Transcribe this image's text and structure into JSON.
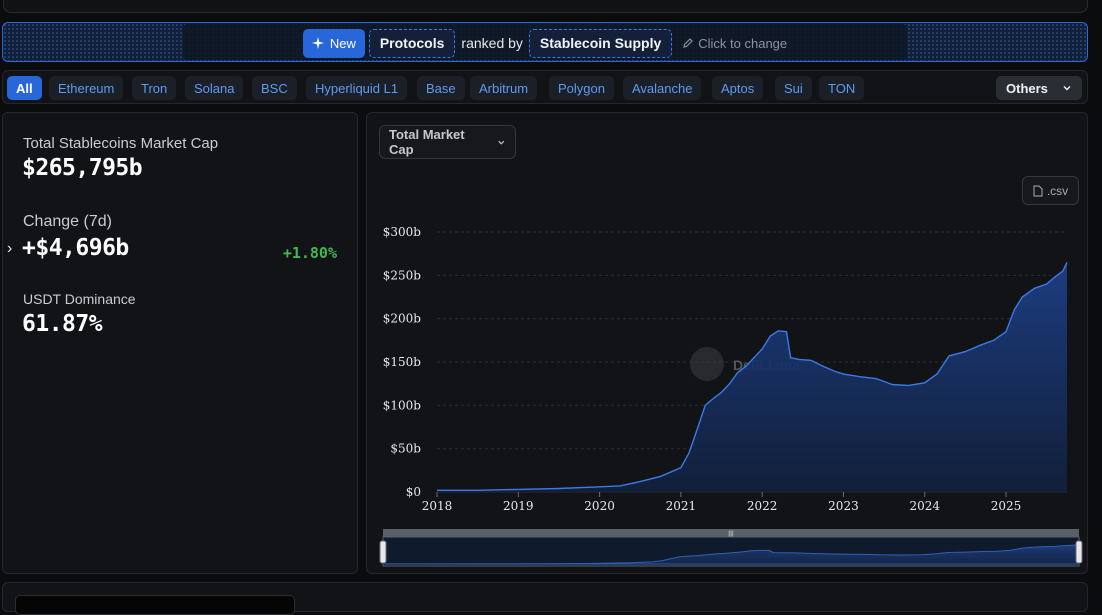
{
  "banner": {
    "new_label": "New",
    "protocols_label": "Protocols",
    "ranked_by": "ranked by",
    "metric_label": "Stablecoin Supply",
    "change_hint": "Click to change"
  },
  "chains": [
    "All",
    "Ethereum",
    "Tron",
    "Solana",
    "BSC",
    "Hyperliquid L1",
    "Base",
    "Arbitrum",
    "Polygon",
    "Avalanche",
    "Aptos",
    "Sui",
    "TON"
  ],
  "active_chain": "All",
  "others_label": "Others",
  "stats": {
    "total_label": "Total Stablecoins Market Cap",
    "total_value": "$265,795b",
    "change_label": "Change (7d)",
    "change_value": "+$4,696b",
    "change_pct": "+1.80%",
    "dominance_label": "USDT Dominance",
    "dominance_value": "61.87%"
  },
  "chart": {
    "dropdown_label": "Total Market Cap",
    "csv_label": ".csv",
    "watermark": "DefiLlama"
  },
  "colors": {
    "accent": "#2767d9",
    "positive": "#3fb950",
    "line": "#3b7ae8"
  },
  "chart_data": {
    "type": "area",
    "title": "",
    "xlabel": "",
    "ylabel": "",
    "y_tick_labels": [
      "$0",
      "$50b",
      "$100b",
      "$150b",
      "$200b",
      "$250b",
      "$300b"
    ],
    "x_tick_labels": [
      "2018",
      "2019",
      "2020",
      "2021",
      "2022",
      "2023",
      "2024",
      "2025"
    ],
    "ylim": [
      0,
      300
    ],
    "xlim": [
      2018.0,
      2025.75
    ],
    "grid": true,
    "series": [
      {
        "x": [
          2018.0,
          2018.5,
          2019.0,
          2019.5,
          2020.0,
          2020.25,
          2020.5,
          2020.75,
          2021.0,
          2021.1,
          2021.2,
          2021.3,
          2021.4,
          2021.5,
          2021.6,
          2021.7,
          2021.8,
          2021.9,
          2022.0,
          2022.1,
          2022.2,
          2022.3,
          2022.35,
          2022.45,
          2022.6,
          2022.75,
          2022.9,
          2023.0,
          2023.2,
          2023.4,
          2023.6,
          2023.8,
          2024.0,
          2024.15,
          2024.3,
          2024.5,
          2024.7,
          2024.85,
          2025.0,
          2025.1,
          2025.2,
          2025.35,
          2025.5,
          2025.6,
          2025.7,
          2025.75
        ],
        "values": [
          2,
          2,
          3,
          4,
          6,
          7,
          12,
          18,
          28,
          45,
          72,
          100,
          108,
          115,
          125,
          138,
          145,
          155,
          165,
          180,
          186,
          185,
          155,
          153,
          152,
          145,
          139,
          136,
          133,
          131,
          124,
          123,
          126,
          136,
          157,
          162,
          170,
          175,
          185,
          210,
          225,
          235,
          240,
          248,
          255,
          265
        ]
      }
    ]
  }
}
